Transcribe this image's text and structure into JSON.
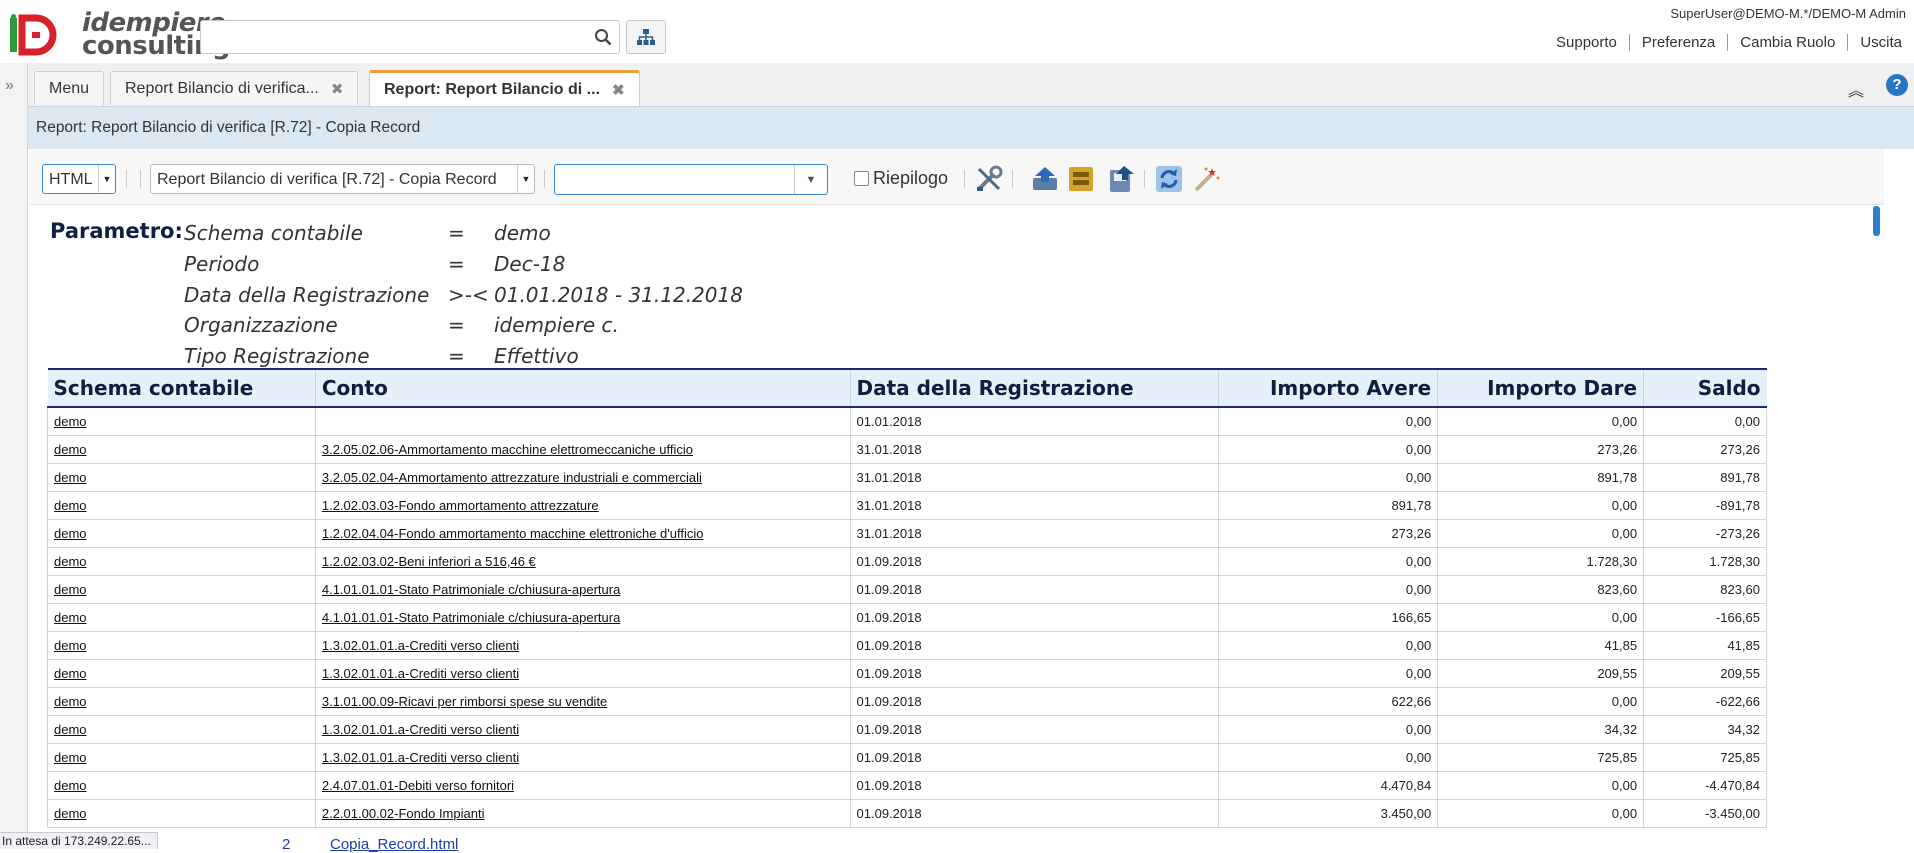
{
  "header": {
    "logo_line1": "idempiere",
    "logo_line2": "consulting",
    "search_placeholder": "",
    "user": "SuperUser@DEMO-M.*/DEMO-M Admin",
    "links": [
      "Supporto",
      "Preferenza",
      "Cambia Ruolo",
      "Uscita"
    ]
  },
  "tabs": [
    {
      "label": "Menu"
    },
    {
      "label": "Report Bilancio di verifica..."
    },
    {
      "label": "Report: Report Bilancio di ..."
    }
  ],
  "window_title": "Report: Report Bilancio di verifica [R.72] - Copia Record",
  "toolbar": {
    "format_value": "HTML",
    "report_view_value": "Report Bilancio di verifica [R.72] - Copia Record",
    "combo_value": "",
    "summary_label": "Riepilogo"
  },
  "params": {
    "heading": "Parametro:",
    "rows": [
      {
        "name": "Schema contabile",
        "op": "=",
        "value": "demo"
      },
      {
        "name": "Periodo",
        "op": "=",
        "value": "Dec-18"
      },
      {
        "name": "Data della Registrazione",
        "op": ">-<",
        "value": "01.01.2018 - 31.12.2018"
      },
      {
        "name": "Organizzazione",
        "op": "=",
        "value": "idempiere c."
      },
      {
        "name": "Tipo Registrazione",
        "op": "=",
        "value": "Effettivo"
      }
    ]
  },
  "table": {
    "columns": [
      "Schema contabile",
      "Conto",
      "Data della Registrazione",
      "Importo Avere",
      "Importo Dare",
      "Saldo"
    ],
    "rows": [
      [
        "demo",
        "",
        "01.01.2018",
        "0,00",
        "0,00",
        "0,00"
      ],
      [
        "demo",
        "3.2.05.02.06-Ammortamento macchine elettromeccaniche ufficio",
        "31.01.2018",
        "0,00",
        "273,26",
        "273,26"
      ],
      [
        "demo",
        "3.2.05.02.04-Ammortamento attrezzature industriali e commerciali",
        "31.01.2018",
        "0,00",
        "891,78",
        "891,78"
      ],
      [
        "demo",
        "1.2.02.03.03-Fondo ammortamento attrezzature",
        "31.01.2018",
        "891,78",
        "0,00",
        "-891,78"
      ],
      [
        "demo",
        "1.2.02.04.04-Fondo ammortamento macchine elettroniche d'ufficio",
        "31.01.2018",
        "273,26",
        "0,00",
        "-273,26"
      ],
      [
        "demo",
        "1.2.02.03.02-Beni inferiori a 516,46 €",
        "01.09.2018",
        "0,00",
        "1.728,30",
        "1.728,30"
      ],
      [
        "demo",
        "4.1.01.01.01-Stato Patrimoniale c/chiusura-apertura",
        "01.09.2018",
        "0,00",
        "823,60",
        "823,60"
      ],
      [
        "demo",
        "4.1.01.01.01-Stato Patrimoniale c/chiusura-apertura",
        "01.09.2018",
        "166,65",
        "0,00",
        "-166,65"
      ],
      [
        "demo",
        "1.3.02.01.01.a-Crediti verso clienti",
        "01.09.2018",
        "0,00",
        "41,85",
        "41,85"
      ],
      [
        "demo",
        "1.3.02.01.01.a-Crediti verso clienti",
        "01.09.2018",
        "0,00",
        "209,55",
        "209,55"
      ],
      [
        "demo",
        "3.1.01.00.09-Ricavi per rimborsi spese su vendite",
        "01.09.2018",
        "622,66",
        "0,00",
        "-622,66"
      ],
      [
        "demo",
        "1.3.02.01.01.a-Crediti verso clienti",
        "01.09.2018",
        "0,00",
        "34,32",
        "34,32"
      ],
      [
        "demo",
        "1.3.02.01.01.a-Crediti verso clienti",
        "01.09.2018",
        "0,00",
        "725,85",
        "725,85"
      ],
      [
        "demo",
        "2.4.07.01.01-Debiti verso fornitori",
        "01.09.2018",
        "4.470,84",
        "0,00",
        "-4.470,84"
      ],
      [
        "demo",
        "2.2.01.00.02-Fondo Impianti",
        "01.09.2018",
        "3.450,00",
        "0,00",
        "-3.450,00"
      ]
    ]
  },
  "status": "In attesa di 173.249.22.65...",
  "bottom_link": "Copia_Record.html",
  "bottom_link_prefix": "2",
  "colors": {
    "accent_tab": "#f0a030",
    "title_strip": "#dbe7f1",
    "table_header": "#e6f0fb",
    "logo_red": "#d8222a",
    "logo_green": "#2e9b3a"
  }
}
